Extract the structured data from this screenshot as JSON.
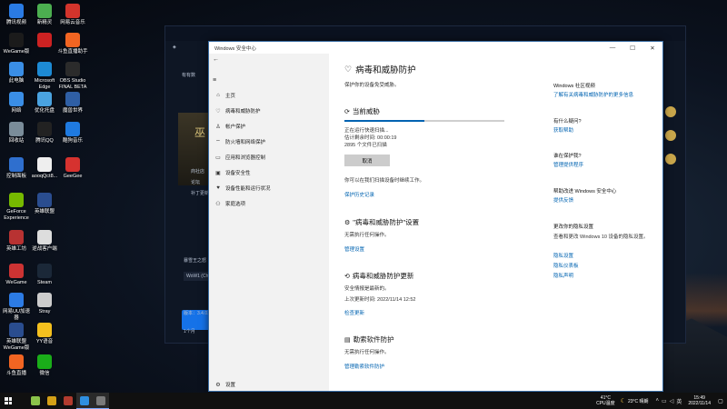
{
  "desktop": {
    "icons": [
      {
        "label": "腾讯视频",
        "color": "#2a7be4"
      },
      {
        "label": "新精灵",
        "color": "#4caf50"
      },
      {
        "label": "网易云音乐",
        "color": "#d3342c"
      },
      {
        "label": "WeGame版",
        "color": "#1b1b1b"
      },
      {
        "label": "",
        "color": "#cc2222"
      },
      {
        "label": "斗鱼直播助手",
        "color": "#f26522"
      },
      {
        "label": "此电脑",
        "color": "#3a8ee6"
      },
      {
        "label": "Microsoft Edge",
        "color": "#1d8ad4"
      },
      {
        "label": "OBS Studio FINAL BETA",
        "color": "#2b2b2b"
      },
      {
        "label": "网络",
        "color": "#3a8ee6"
      },
      {
        "label": "优化托盘",
        "color": "#4aa3e0"
      },
      {
        "label": "魔兽世界",
        "color": "#2f5fa5"
      },
      {
        "label": "回收站",
        "color": "#7a8c99"
      },
      {
        "label": "腾讯QQ",
        "color": "#222222"
      },
      {
        "label": "酷狗音乐",
        "color": "#1f7ae0"
      },
      {
        "label": "控制面板",
        "color": "#2f6fce"
      },
      {
        "label": "aooqQct8...",
        "color": "#eeeeee"
      },
      {
        "label": "GeeGee",
        "color": "#d6322f"
      },
      {
        "label": "GeForce Experience",
        "color": "#76b900"
      },
      {
        "label": "英雄联盟",
        "color": "#2a4d8f"
      },
      {
        "label": "英雄工坊",
        "color": "#b83232"
      },
      {
        "label": "逆战客户端",
        "color": "#dddddd"
      },
      {
        "label": "WeGame",
        "color": "#cc3333"
      },
      {
        "label": "Steam",
        "color": "#1b2838"
      },
      {
        "label": "网易UU加速器",
        "color": "#2c7be5"
      },
      {
        "label": "Stray",
        "color": "#cccccc"
      },
      {
        "label": "英雄联盟WeGame版",
        "color": "#2a4d8f"
      },
      {
        "label": "YY语音",
        "color": "#f4c01e"
      },
      {
        "label": "斗鱼直播",
        "color": "#f26522"
      },
      {
        "label": "微信",
        "color": "#1aad19"
      }
    ]
  },
  "background_app": {
    "texts": [
      "有有数",
      "巫",
      "商社店",
      "论坛",
      "补丁更新",
      "暴雪王之怒",
      "WoW1 (Ch",
      "版本：3.4.0.4",
      "1个月"
    ]
  },
  "window": {
    "title": "Windows 安全中心",
    "controls": {
      "minimize": "—",
      "maximize": "☐",
      "close": "✕"
    }
  },
  "nav": {
    "back": "←",
    "menu": "≡",
    "items": [
      {
        "label": "主页",
        "icon": "⌂"
      },
      {
        "label": "病毒和威胁防护",
        "icon": "♡"
      },
      {
        "label": "帐户保护",
        "icon": "♙"
      },
      {
        "label": "防火墙和网络保护",
        "icon": "⌔"
      },
      {
        "label": "应用和浏览器控制",
        "icon": "▭"
      },
      {
        "label": "设备安全性",
        "icon": "▣"
      },
      {
        "label": "设备性能和运行状况",
        "icon": "♥"
      },
      {
        "label": "家庭选项",
        "icon": "⚇"
      }
    ],
    "settings": {
      "label": "设置",
      "icon": "⚙"
    }
  },
  "main": {
    "title": "病毒和威胁防护",
    "subtitle": "保护你的设备免受威胁。",
    "current_threats": {
      "heading": "当前威胁",
      "progress": 0.5,
      "status_line": "正在运行快速扫描...",
      "time_left": "估计剩余时间: 00:00:19",
      "files_scanned": "2895 个文件已扫描",
      "cancel_label": "取消",
      "note": "你可以在我们扫描设备时继续工作。",
      "history_link": "保护历史记录"
    },
    "settings_section": {
      "heading": "\"病毒和威胁防护\"设置",
      "desc": "无需执行任何操作。",
      "link": "管理设置"
    },
    "updates_section": {
      "heading": "病毒和威胁防护更新",
      "desc": "安全情报是最新的。",
      "last_update": "上次更新时间: 2022/11/14 12:52",
      "link": "检查更新"
    },
    "ransomware_section": {
      "heading": "勒索软件防护",
      "desc": "无需执行任何操作。",
      "link": "管理勒索软件防护"
    }
  },
  "sidebar": {
    "community": {
      "heading": "Windows 社区视频",
      "link": "了解有关病毒和威胁防护的更多信息"
    },
    "question": {
      "heading": "有什么疑问?",
      "link": "获取帮助"
    },
    "protect": {
      "heading": "谁在保护我?",
      "link": "管理提供程序"
    },
    "improve": {
      "heading": "帮助改进 Windows 安全中心",
      "link": "提供反馈"
    },
    "privacy": {
      "heading": "更改你的隐私设置",
      "desc": "查看和更改 Windows 10 设备的隐私设置。",
      "links": [
        "隐私设置",
        "隐私仪表板",
        "隐私声明"
      ]
    }
  },
  "taskbar": {
    "apps": [
      {
        "name": "gamesdk",
        "color": "#8bc34a",
        "active": false
      },
      {
        "name": "overwolf",
        "color": "#d4a017",
        "active": false
      },
      {
        "name": "wow",
        "color": "#b23b2e",
        "active": false
      },
      {
        "name": "battlenet",
        "color": "#2f8fe0",
        "active": true
      },
      {
        "name": "security",
        "color": "#7a7a7a",
        "active": true
      }
    ],
    "cpu_temp": "41°C",
    "cpu_label": "CPU温度",
    "weather": "23°C 晴朗",
    "time": "15:49",
    "date": "2022/11/14"
  }
}
